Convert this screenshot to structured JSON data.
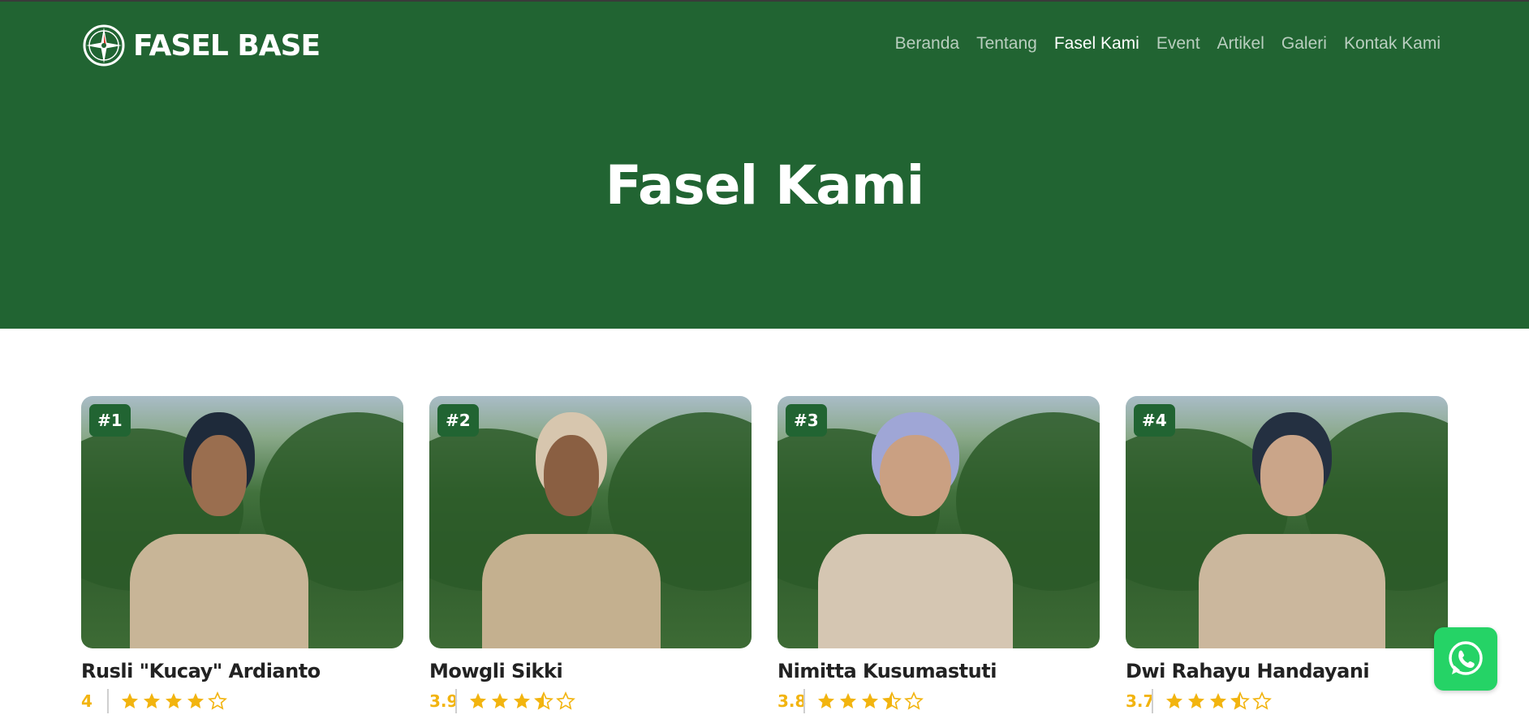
{
  "header": {
    "logo_text": "FASEL BASE",
    "logo_icon": "compass-icon",
    "nav": [
      {
        "label": "Beranda",
        "active": false
      },
      {
        "label": "Tentang",
        "active": false
      },
      {
        "label": "Fasel Kami",
        "active": true
      },
      {
        "label": "Event",
        "active": false
      },
      {
        "label": "Artikel",
        "active": false
      },
      {
        "label": "Galeri",
        "active": false
      },
      {
        "label": "Kontak Kami",
        "active": false
      }
    ]
  },
  "hero": {
    "title": "Fasel Kami"
  },
  "cards": [
    {
      "rank": "#1",
      "name": "Rusli \"Kucay\" Ardianto",
      "score": "4",
      "rating": 4
    },
    {
      "rank": "#2",
      "name": "Mowgli Sikki",
      "score": "3.9",
      "rating": 3.5
    },
    {
      "rank": "#3",
      "name": "Nimitta Kusumastuti",
      "score": "3.8",
      "rating": 3.5
    },
    {
      "rank": "#4",
      "name": "Dwi Rahayu Handayani",
      "score": "3.7",
      "rating": 3.5
    }
  ],
  "floating": {
    "icon": "whatsapp-icon"
  },
  "colors": {
    "brand_green": "#216432",
    "star_gold": "#f2b40f",
    "whatsapp": "#25d366"
  }
}
